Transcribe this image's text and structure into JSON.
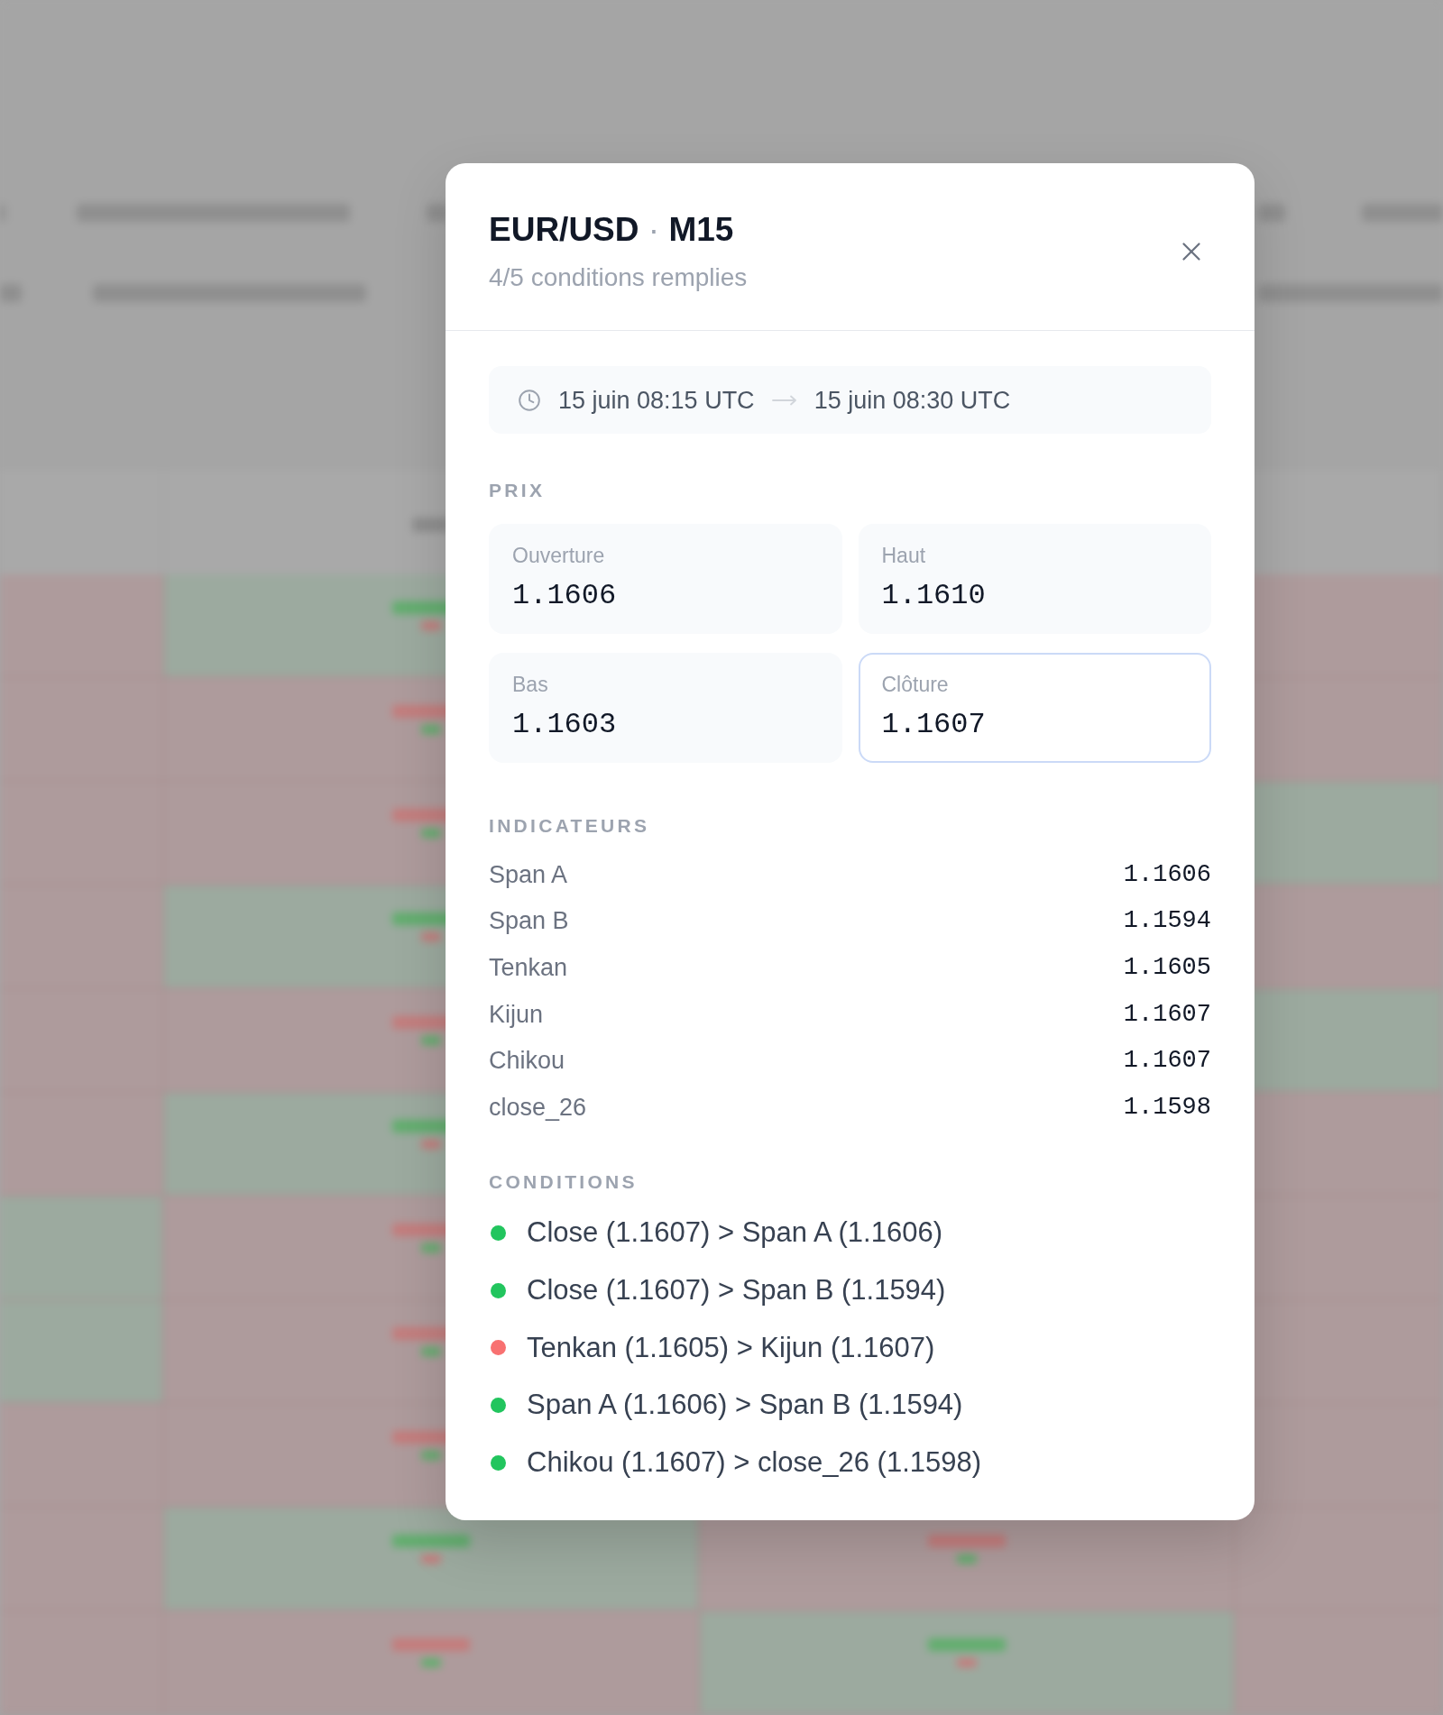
{
  "dialog": {
    "title": {
      "symbol": "EUR/USD",
      "separator": "·",
      "timeframe": "M15"
    },
    "subtitle": "4/5 conditions remplies"
  },
  "period": {
    "start": "15 juin 08:15 UTC",
    "end": "15 juin 08:30 UTC"
  },
  "prices": {
    "label": "PRIX",
    "cards": [
      {
        "label": "Ouverture",
        "value": "1.1606",
        "highlighted": false
      },
      {
        "label": "Haut",
        "value": "1.1610",
        "highlighted": false
      },
      {
        "label": "Bas",
        "value": "1.1603",
        "highlighted": false
      },
      {
        "label": "Clôture",
        "value": "1.1607",
        "highlighted": true
      }
    ]
  },
  "indicators": {
    "label": "INDICATEURS",
    "rows": [
      {
        "name": "Span A",
        "value": "1.1606"
      },
      {
        "name": "Span B",
        "value": "1.1594"
      },
      {
        "name": "Tenkan",
        "value": "1.1605"
      },
      {
        "name": "Kijun",
        "value": "1.1607"
      },
      {
        "name": "Chikou",
        "value": "1.1607"
      },
      {
        "name": "close_26",
        "value": "1.1598"
      }
    ]
  },
  "conditions": {
    "label": "CONDITIONS",
    "items": [
      {
        "text": "Close (1.1607) > Span A (1.1606)",
        "color": "#22c55e"
      },
      {
        "text": "Close (1.1607) > Span B (1.1594)",
        "color": "#22c55e"
      },
      {
        "text": "Tenkan (1.1605) > Kijun (1.1607)",
        "color": "#f87171"
      },
      {
        "text": "Span A (1.1606) > Span B (1.1594)",
        "color": "#22c55e"
      },
      {
        "text": "Chikou (1.1607) > close_26 (1.1598)",
        "color": "#22c55e"
      }
    ]
  }
}
